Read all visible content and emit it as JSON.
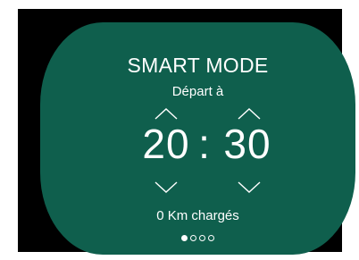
{
  "mode": {
    "title": "SMART MODE",
    "subtitle": "Départ à"
  },
  "time": {
    "hours": "20",
    "separator": ":",
    "minutes": "30"
  },
  "status": {
    "charge_text": "0 Km chargés"
  },
  "pager": {
    "count": 4,
    "active_index": 0
  },
  "colors": {
    "panel": "#0f5f4d",
    "background": "#000000",
    "text": "#ffffff"
  },
  "icons": {
    "increase": "chevron-up-icon",
    "decrease": "chevron-down-icon"
  }
}
